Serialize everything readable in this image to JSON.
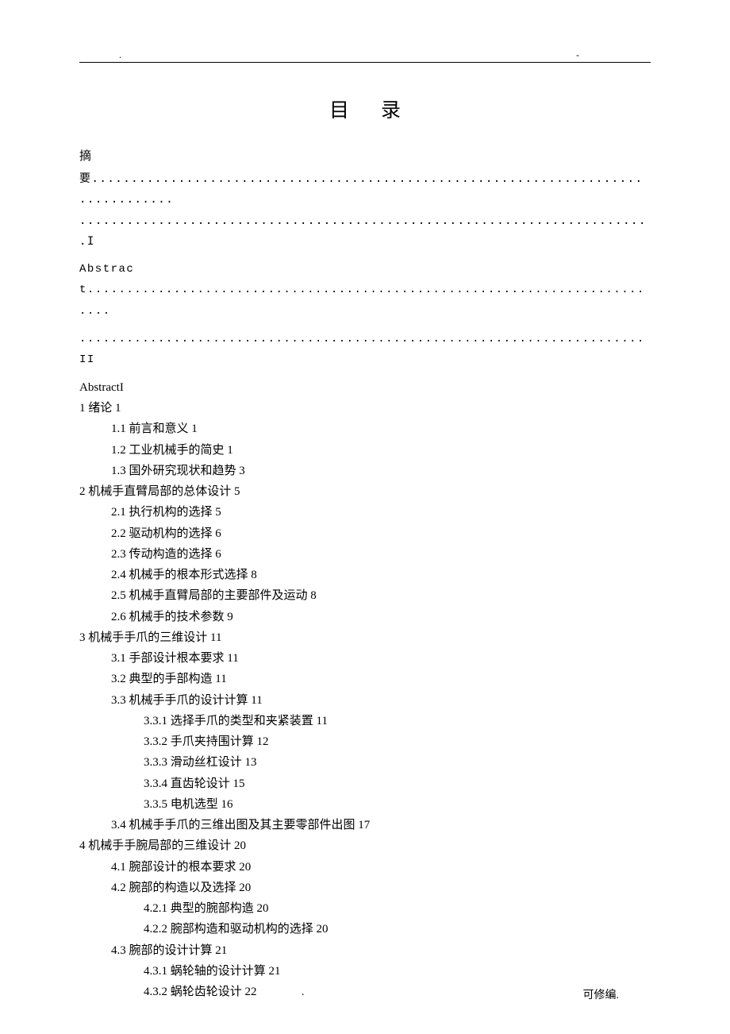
{
  "header": {
    "dot": ".",
    "dash": "-"
  },
  "title": "目录",
  "abstract_block": {
    "line1": "摘",
    "line2": "要..................................................................................",
    "line3": ".........................................................................I",
    "line4": "Abstract...........................................................................",
    "line5": "........................................................................II"
  },
  "toc": [
    {
      "level": 0,
      "text": "AbstractI"
    },
    {
      "level": 0,
      "text": "1 绪论 1"
    },
    {
      "level": 1,
      "text": "1.1 前言和意义 1"
    },
    {
      "level": 1,
      "text": "1.2 工业机械手的简史 1"
    },
    {
      "level": 1,
      "text": "1.3 国外研究现状和趋势 3"
    },
    {
      "level": 0,
      "text": "2 机械手直臂局部的总体设计 5"
    },
    {
      "level": 1,
      "text": "2.1 执行机构的选择 5"
    },
    {
      "level": 1,
      "text": "2.2 驱动机构的选择 6"
    },
    {
      "level": 1,
      "text": "2.3 传动构造的选择 6"
    },
    {
      "level": 1,
      "text": "2.4 机械手的根本形式选择 8"
    },
    {
      "level": 1,
      "text": "2.5 机械手直臂局部的主要部件及运动 8"
    },
    {
      "level": 1,
      "text": "2.6 机械手的技术参数 9"
    },
    {
      "level": 0,
      "text": "3 机械手手爪的三维设计 11"
    },
    {
      "level": 1,
      "text": "3.1 手部设计根本要求 11"
    },
    {
      "level": 1,
      "text": "3.2 典型的手部构造 11"
    },
    {
      "level": 1,
      "text": "3.3 机械手手爪的设计计算 11"
    },
    {
      "level": 2,
      "text": "3.3.1 选择手爪的类型和夹紧装置 11"
    },
    {
      "level": 2,
      "text": "3.3.2 手爪夹持围计算 12"
    },
    {
      "level": 2,
      "text": "3.3.3 滑动丝杠设计 13"
    },
    {
      "level": 2,
      "text": "3.3.4 直齿轮设计 15"
    },
    {
      "level": 2,
      "text": "3.3.5 电机选型 16"
    },
    {
      "level": 1,
      "text": "3.4 机械手手爪的三维出图及其主要零部件出图 17"
    },
    {
      "level": 0,
      "text": "4 机械手手腕局部的三维设计 20"
    },
    {
      "level": 1,
      "text": "4.1 腕部设计的根本要求 20"
    },
    {
      "level": 1,
      "text": "4.2 腕部的构造以及选择 20"
    },
    {
      "level": 2,
      "text": "4.2.1 典型的腕部构造 20"
    },
    {
      "level": 2,
      "text": "4.2.2 腕部构造和驱动机构的选择 20"
    },
    {
      "level": 1,
      "text": "4.3 腕部的设计计算 21"
    },
    {
      "level": 2,
      "text": "4.3.1 蜗轮轴的设计计算 21"
    },
    {
      "level": 2,
      "text": "4.3.2 蜗轮齿轮设计 22"
    }
  ],
  "footer": {
    "dot": ".",
    "text": "可修编."
  }
}
